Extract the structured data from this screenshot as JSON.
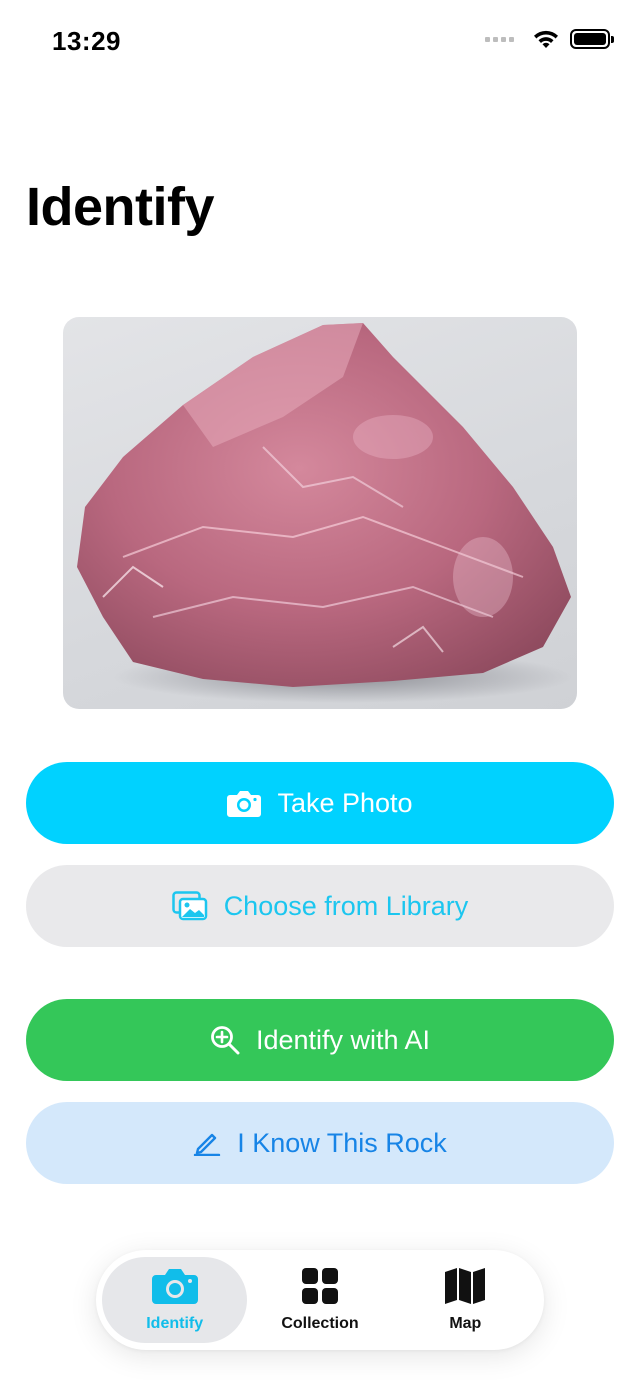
{
  "status_bar": {
    "time": "13:29"
  },
  "header": {
    "title": "Identify"
  },
  "photo": {
    "subject": "pink rose quartz rock"
  },
  "actions": {
    "take_photo": {
      "label": "Take Photo",
      "icon": "camera-icon"
    },
    "choose_library": {
      "label": "Choose from Library",
      "icon": "photo-library-icon"
    },
    "identify_ai": {
      "label": "Identify with AI",
      "icon": "magnify-plus-icon"
    },
    "know_rock": {
      "label": "I Know This Rock",
      "icon": "pencil-icon"
    }
  },
  "tab_bar": {
    "tabs": [
      {
        "label": "Identify",
        "icon": "camera-icon",
        "active": true
      },
      {
        "label": "Collection",
        "icon": "grid-icon",
        "active": false
      },
      {
        "label": "Map",
        "icon": "map-icon",
        "active": false
      }
    ]
  },
  "colors": {
    "primary": "#00d2ff",
    "ai_green": "#34c759",
    "know_bg": "#d4e8fb",
    "know_text": "#1784e6",
    "library_bg": "#e9e9eb"
  }
}
